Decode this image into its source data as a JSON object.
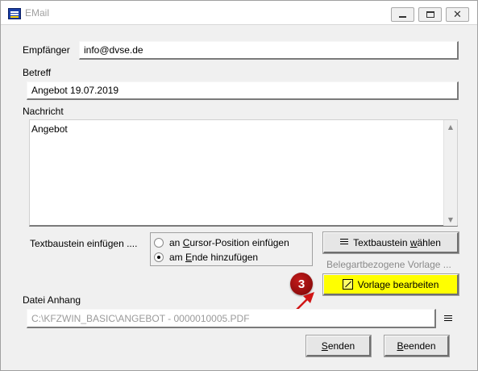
{
  "window": {
    "title": "EMail",
    "controls": [
      "minimize",
      "maximize",
      "close"
    ]
  },
  "form": {
    "recipient_label": "Empfänger",
    "recipient_value": "info@dvse.de",
    "subject_label": "Betreff",
    "subject_value": "Angebot 19.07.2019",
    "message_label": "Nachricht",
    "message_value": "Angebot",
    "textblock_label": "Textbaustein einfügen ....",
    "radio_cursor_pre": "an ",
    "radio_cursor_accel": "C",
    "radio_cursor_post": "ursor-Position einfügen",
    "radio_end_pre": "am ",
    "radio_end_accel": "E",
    "radio_end_post": "nde hinzufügen",
    "radio_selected": "am_ende",
    "choose_textblock_pre": "Textbaustein ",
    "choose_textblock_accel": "w",
    "choose_textblock_post": "ählen",
    "template_label": "Belegartbezogene Vorlage ...",
    "edit_template_button": "Vorlage bearbeiten",
    "attachment_label": "Datei Anhang",
    "attachment_value": "C:\\KFZWIN_BASIC\\ANGEBOT - 0000010005.PDF",
    "send_pre": "",
    "send_accel": "S",
    "send_post": "enden",
    "quit_pre": "",
    "quit_accel": "B",
    "quit_post": "eenden"
  },
  "annotation": {
    "badge_number": "3"
  },
  "colors": {
    "highlight_button": "#ffff00",
    "annotation": "#b01010"
  },
  "icons": {
    "app": "email-app-icon",
    "textblock_button": "list-icon",
    "template_button": "pen-icon",
    "attachment_browse": "list-icon"
  }
}
